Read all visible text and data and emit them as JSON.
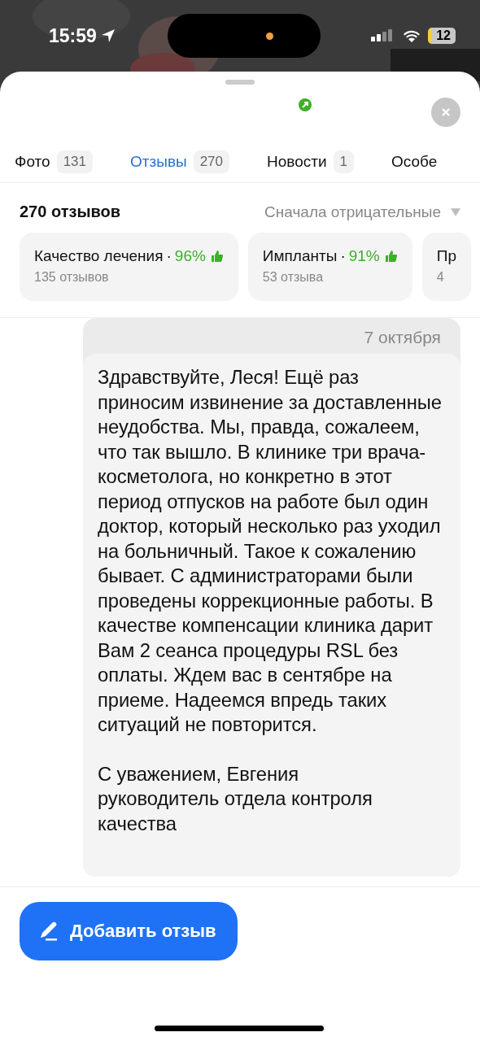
{
  "status_bar": {
    "time": "15:59",
    "battery": "12"
  },
  "tabs": [
    {
      "label": "Фото",
      "count": "131",
      "selected": false
    },
    {
      "label": "Отзывы",
      "count": "270",
      "selected": true
    },
    {
      "label": "Новости",
      "count": "1",
      "selected": false
    },
    {
      "label": "Особе",
      "selected": false
    }
  ],
  "reviews_header": {
    "title": "270 отзывов",
    "sort": "Сначала отрицательные"
  },
  "aspects": [
    {
      "name": "Качество лечения",
      "separator": "·",
      "percent": "96%",
      "count": "135 отзывов"
    },
    {
      "name": "Импланты",
      "separator": "·",
      "percent": "91%",
      "count": "53 отзыва"
    },
    {
      "name": "Пр",
      "count": "4"
    }
  ],
  "reply": {
    "date": "7 октября",
    "text": "Здравствуйте, Леся! Ещё раз приносим извинение за доставленные неудобства. Мы, правда, сожалеем, что так вышло. В клинике три врача-косметолога, но конкретно в этот период отпусков на работе был один доктор, который несколько раз уходил на больничный. Такое к сожалению бывает. С администраторами были проведены коррекционные работы. В качестве компенсации клиника дарит Вам 2 сеанса процедуры RSL без оплаты. Ждем вас в сентябре на приеме. Надеемся впредь таких ситуаций не повторится.",
    "signature": "С уважением, Евгения\nруководитель отдела контроля качества"
  },
  "add_button": {
    "label": "Добавить отзыв"
  }
}
